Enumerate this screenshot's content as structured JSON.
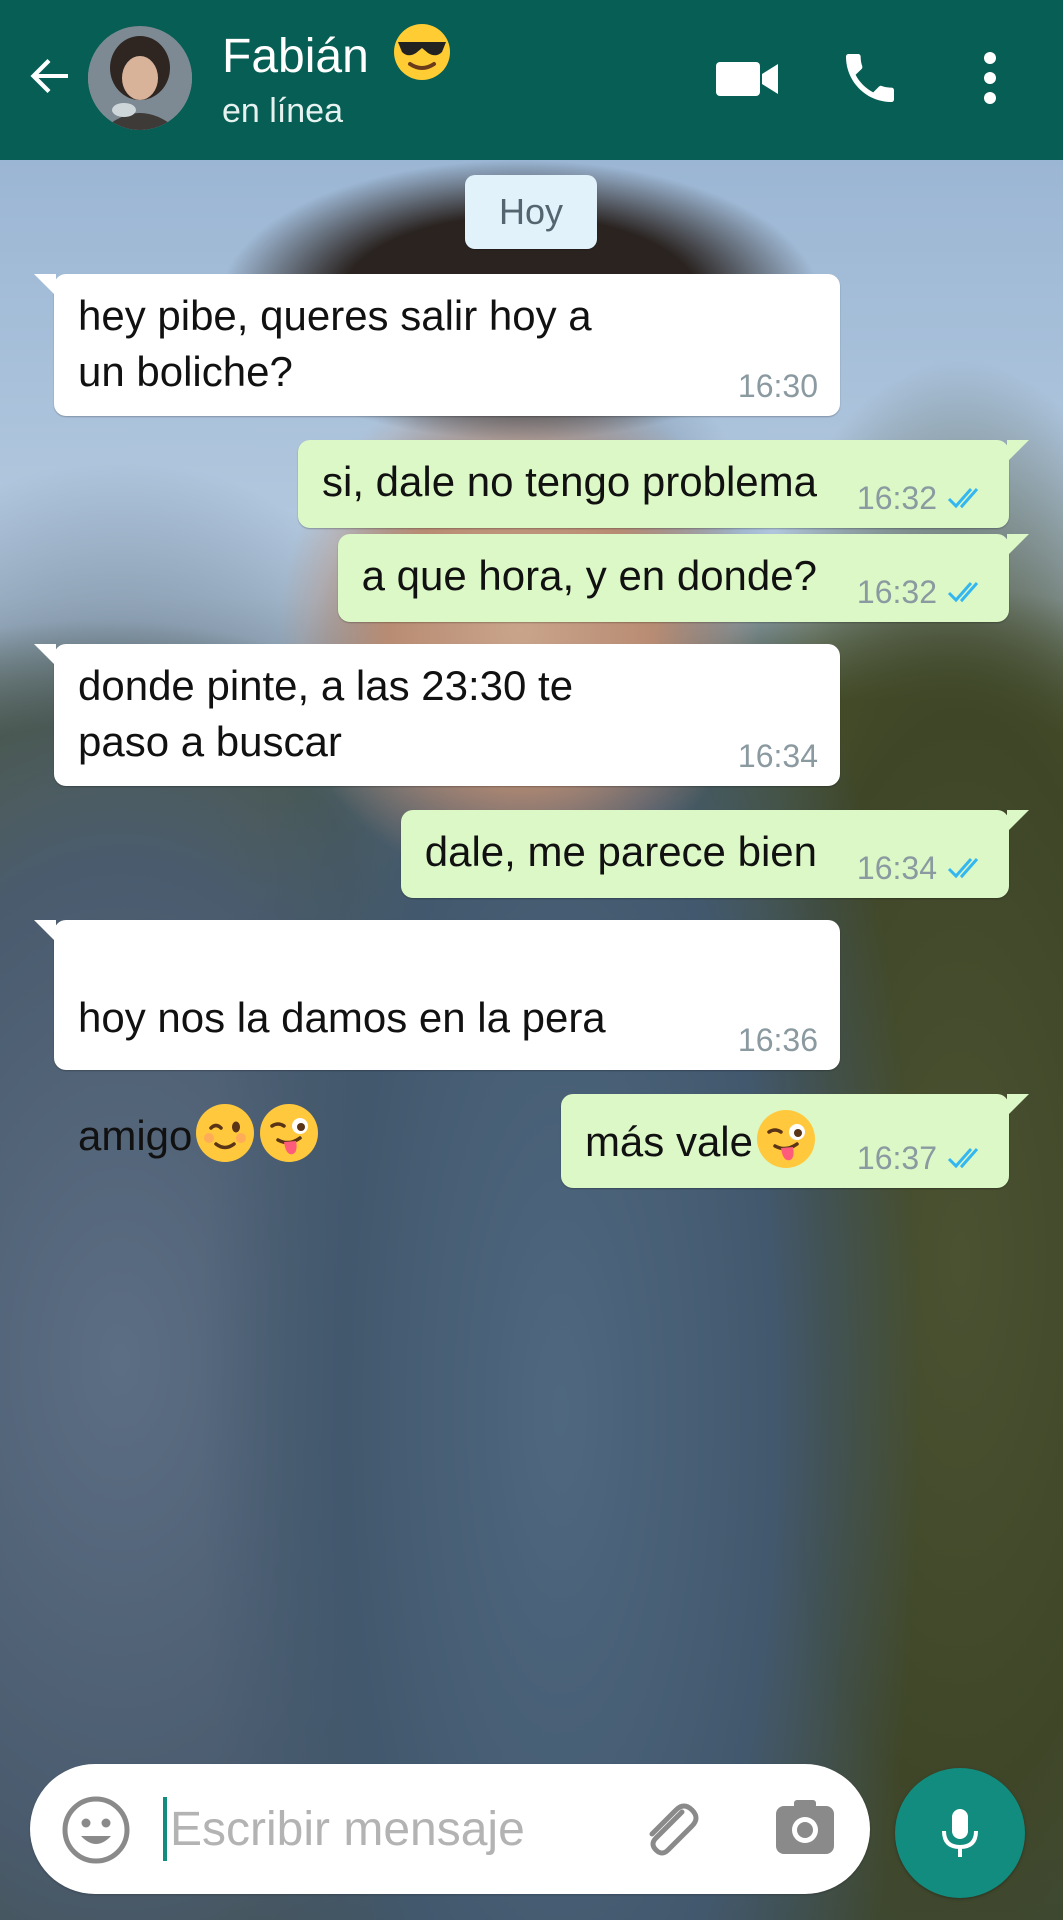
{
  "header": {
    "contact_name": "Fabián",
    "status": "en línea"
  },
  "chat": {
    "date_chip": "Hoy",
    "messages": [
      {
        "direction": "in",
        "text": "hey pibe, queres salir hoy a\nun boliche?",
        "time": "16:30"
      },
      {
        "direction": "out",
        "text": "si, dale no tengo problema",
        "time": "16:32",
        "status": "read"
      },
      {
        "direction": "out",
        "text": "a que hora, y en donde?",
        "time": "16:32",
        "status": "read"
      },
      {
        "direction": "in",
        "text": "donde pinte, a las 23:30 te\npaso a buscar",
        "time": "16:34"
      },
      {
        "direction": "out",
        "text": "dale, me parece bien",
        "time": "16:34",
        "status": "read"
      },
      {
        "direction": "in",
        "line1": "hoy nos la damos en la pera",
        "line2": "amigo",
        "emojis": [
          "winking-face",
          "winking-face-with-tongue"
        ],
        "time": "16:36"
      },
      {
        "direction": "out",
        "text": "más vale",
        "emojis": [
          "winking-face-with-tongue"
        ],
        "time": "16:37",
        "status": "read"
      }
    ]
  },
  "composer": {
    "placeholder": "Escribir mensaje"
  },
  "colors": {
    "header": "#075e54",
    "outgoing_bubble": "#dcf8c6",
    "incoming_bubble": "#ffffff",
    "read_ticks": "#34b7f1",
    "mic_button": "#128c7e"
  }
}
